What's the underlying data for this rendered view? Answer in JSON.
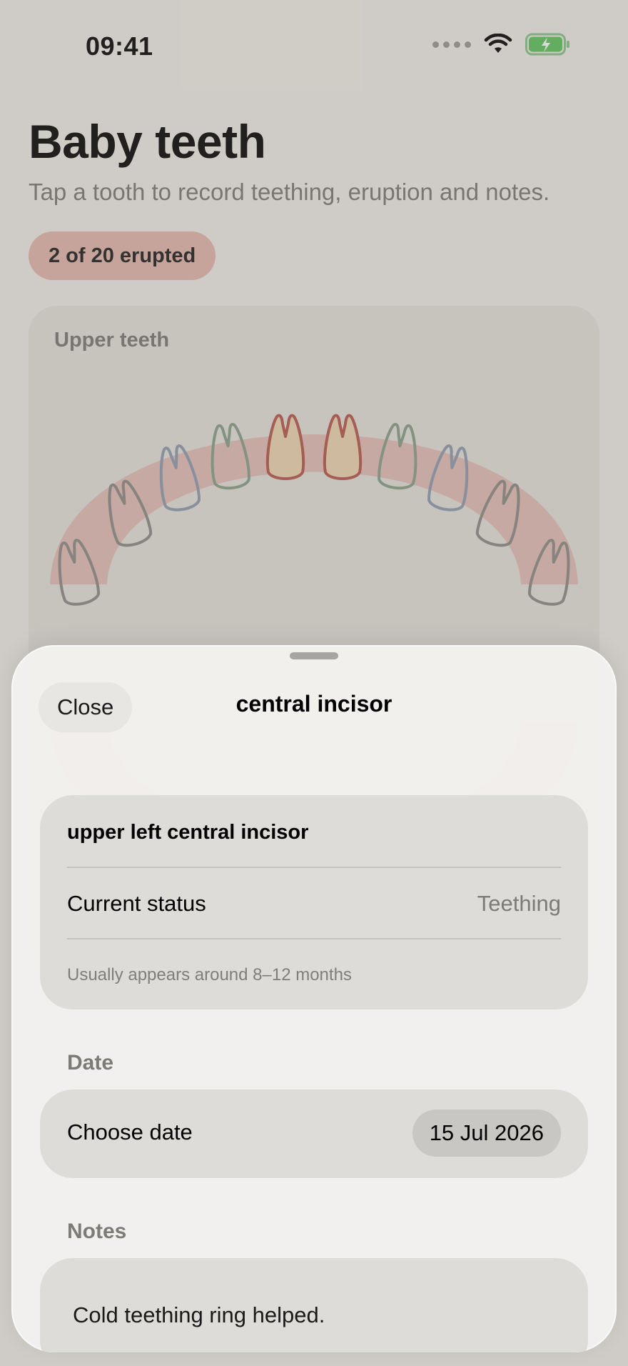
{
  "status_bar": {
    "time": "09:41"
  },
  "header": {
    "title": "Baby teeth",
    "subtitle": "Tap a tooth to record teething, eruption and notes.",
    "progress": "2 of 20 erupted"
  },
  "upper_card": {
    "label": "Upper teeth"
  },
  "colors": {
    "gum": "#e4b2aa",
    "erupted_fill": "#f0d6b2",
    "erupted_outline": "#b8554c",
    "teething_outline": "#8aa08a",
    "upcoming_outline_blue": "#8f9bb0",
    "upcoming_outline_gray": "#8e8a86"
  },
  "sheet": {
    "close_label": "Close",
    "title": "central incisor",
    "tooth_name": "upper left central incisor",
    "status_label": "Current status",
    "status_value": "Teething",
    "hint": "Usually appears around 8–12 months",
    "date_section": "Date",
    "date_label": "Choose date",
    "date_value": "15 Jul 2026",
    "notes_section": "Notes",
    "notes_value": "Cold teething ring helped."
  }
}
